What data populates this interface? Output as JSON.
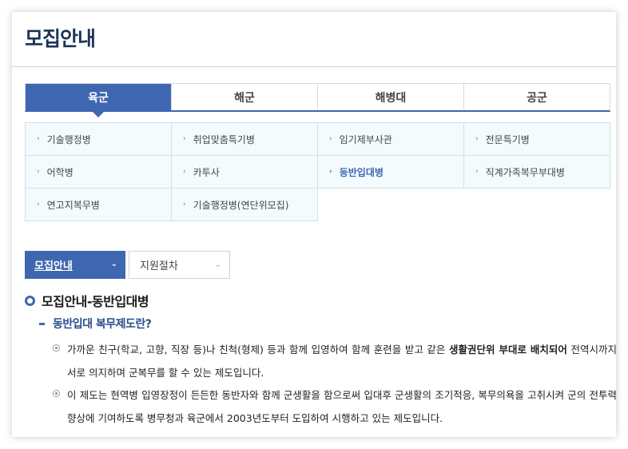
{
  "page": {
    "title": "모집안내"
  },
  "branch_tabs": [
    {
      "label": "육군",
      "active": true
    },
    {
      "label": "해군",
      "active": false
    },
    {
      "label": "해병대",
      "active": false
    },
    {
      "label": "공군",
      "active": false
    }
  ],
  "sub_menu": [
    {
      "label": "기술행정병",
      "active": false
    },
    {
      "label": "취업맞춤특기병",
      "active": false
    },
    {
      "label": "임기제부사관",
      "active": false
    },
    {
      "label": "전문특기병",
      "active": false
    },
    {
      "label": "어학병",
      "active": false
    },
    {
      "label": "카투사",
      "active": false
    },
    {
      "label": "동반입대병",
      "active": true
    },
    {
      "label": "직계가족복무부대병",
      "active": false
    },
    {
      "label": "연고지복무병",
      "active": false
    },
    {
      "label": "기술행정병(연단위모집)",
      "active": false
    }
  ],
  "selects": {
    "primary_value": "모집안내",
    "secondary_value": "지원절차"
  },
  "section": {
    "title": "모집안내-동반입대병",
    "subtitle": "동반입대 복무제도란?",
    "para1_before": "가까운 친구(학교, 고향, 직장 등)나 친척(형제) 등과 함께 입영하여 함께 훈련을 받고 같은 ",
    "para1_bold": "생활권단위 부대로 배치되어",
    "para1_after": " 전역시까지 서로 의지하며 군복무를 할 수 있는 제도입니다.",
    "para2": "이 제도는 현역병 입영장정이 든든한 동반자와 함께 군생활을 함으로써 입대후 군생활의 조기적응, 복무의욕을 고취시켜 군의 전투력 향상에 기여하도록 병무청과 육군에서 2003년도부터 도입하여 시행하고 있는 제도입니다."
  },
  "colors": {
    "accent": "#3f67b1",
    "title": "#1d3358",
    "sub_bg": "#f3fbfd"
  }
}
